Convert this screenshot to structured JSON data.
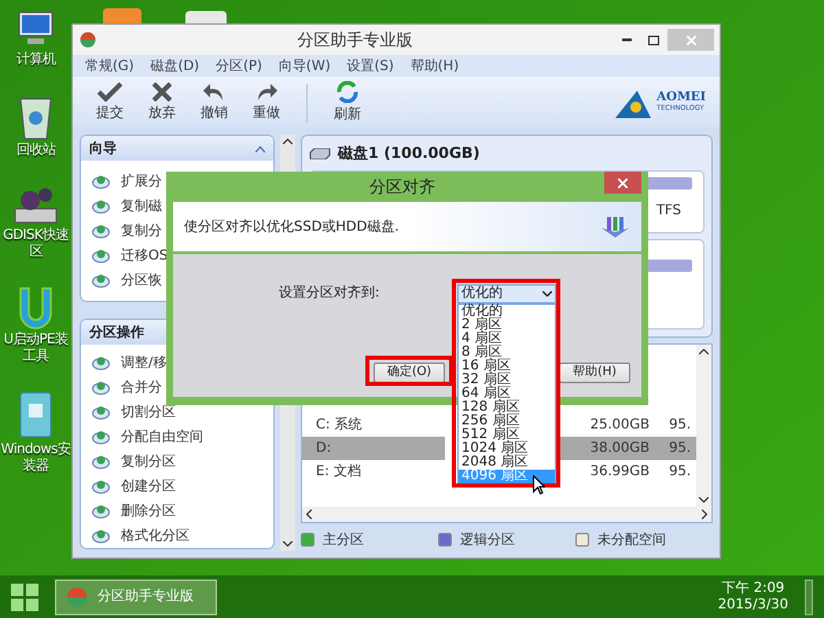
{
  "desktop_icons": [
    {
      "kind": "computer",
      "lines": [
        "计算机"
      ]
    },
    {
      "kind": "trash",
      "lines": [
        "回收站"
      ]
    },
    {
      "kind": "disk",
      "lines": [
        "GDISK快速",
        "区"
      ]
    },
    {
      "kind": "u",
      "lines": [
        "U启动PE装",
        "工具"
      ]
    },
    {
      "kind": "installer",
      "lines": [
        "Windows安",
        "装器"
      ]
    }
  ],
  "app": {
    "title": "分区助手专业版",
    "menu": [
      "常规(G)",
      "磁盘(D)",
      "分区(P)",
      "向导(W)",
      "设置(S)",
      "帮助(H)"
    ],
    "toolbar": [
      {
        "kind": "check",
        "label": "提交"
      },
      {
        "kind": "cross",
        "label": "放弃"
      },
      {
        "kind": "undo",
        "label": "撤销"
      },
      {
        "kind": "redo",
        "label": "重做"
      },
      {
        "kind": "refresh",
        "label": "刷新"
      }
    ],
    "logo": {
      "name": "AOMEI",
      "tagline": "TECHNOLOGY"
    },
    "sidebar": [
      {
        "title": "向导",
        "items": [
          "扩展分",
          "复制磁",
          "复制分",
          "迁移OS",
          "分区恢"
        ]
      },
      {
        "title": "分区操作",
        "items": [
          "调整/移",
          "合并分",
          "切割分区",
          "分配自由空间",
          "复制分区",
          "创建分区",
          "删除分区",
          "格式化分区"
        ]
      }
    ],
    "disk": {
      "title": "磁盘1 (100.00GB)",
      "filesystem": "TFS"
    },
    "table": {
      "rows": [
        {
          "cells": [
            "C: 系统",
            "25.00GB",
            "95."
          ],
          "selected": false
        },
        {
          "cells": [
            "D:",
            "38.00GB",
            "95."
          ],
          "selected": true
        },
        {
          "cells": [
            "E: 文档",
            "36.99GB",
            "95."
          ],
          "selected": false
        }
      ]
    },
    "legend": [
      {
        "label": "主分区",
        "color": "#3fae3f"
      },
      {
        "label": "逻辑分区",
        "color": "#6a6ad0"
      },
      {
        "label": "未分配空间",
        "color": "#eeeadc"
      }
    ]
  },
  "dialog": {
    "title": "分区对齐",
    "description": "使分区对齐以优化SSD或HDD磁盘.",
    "label": "设置分区对齐到:",
    "select": {
      "value": "优化的",
      "expanded": true,
      "options": [
        {
          "label": "优化的",
          "highlighted": false
        },
        {
          "label": "2 扇区",
          "highlighted": false
        },
        {
          "label": "4 扇区",
          "highlighted": false
        },
        {
          "label": "8 扇区",
          "highlighted": false
        },
        {
          "label": "16 扇区",
          "highlighted": false
        },
        {
          "label": "32 扇区",
          "highlighted": false
        },
        {
          "label": "64 扇区",
          "highlighted": false
        },
        {
          "label": "128 扇区",
          "highlighted": false
        },
        {
          "label": "256 扇区",
          "highlighted": false
        },
        {
          "label": "512 扇区",
          "highlighted": false
        },
        {
          "label": "1024 扇区",
          "highlighted": false
        },
        {
          "label": "2048 扇区",
          "highlighted": false
        },
        {
          "label": "4096 扇区",
          "highlighted": true
        }
      ]
    },
    "buttons": [
      "确定(O)",
      "帮助(H)"
    ]
  },
  "taskbar": {
    "tasks": [
      "分区助手专业版"
    ],
    "time": "下午 2:09",
    "date": "2015/3/30"
  }
}
